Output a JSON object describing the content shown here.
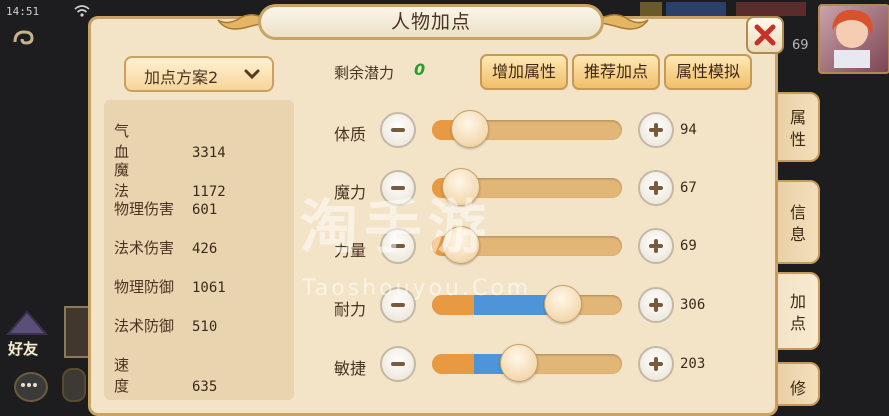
{
  "status": {
    "time": "14:51"
  },
  "hud": {
    "friends_label": "好友",
    "level": "69"
  },
  "dialog": {
    "title": "人物加点"
  },
  "plan": {
    "selected": "加点方案2"
  },
  "stats": [
    {
      "name": "气血",
      "value": "3314",
      "spread": true
    },
    {
      "name": "魔法",
      "value": "1172",
      "spread": true
    },
    {
      "name": "物理伤害",
      "value": "601",
      "spread": false
    },
    {
      "name": "法术伤害",
      "value": "426",
      "spread": false
    },
    {
      "name": "物理防御",
      "value": "1061",
      "spread": false
    },
    {
      "name": "法术防御",
      "value": "510",
      "spread": false
    },
    {
      "name": "速度",
      "value": "635",
      "spread": true
    }
  ],
  "potential": {
    "label": "剩余潜力",
    "value": "0"
  },
  "actions": {
    "add": "增加属性",
    "recommend": "推荐加点",
    "simulate": "属性模拟"
  },
  "attributes": [
    {
      "name": "体质",
      "value": "94",
      "orange_pct": 0.2,
      "blue_pct": 0.0,
      "knob_pct": 0.2
    },
    {
      "name": "魔力",
      "value": "67",
      "orange_pct": 0.15,
      "blue_pct": 0.0,
      "knob_pct": 0.15
    },
    {
      "name": "力量",
      "value": "69",
      "orange_pct": 0.15,
      "blue_pct": 0.0,
      "knob_pct": 0.15
    },
    {
      "name": "耐力",
      "value": "306",
      "orange_pct": 0.22,
      "blue_pct": 0.47,
      "knob_pct": 0.69
    },
    {
      "name": "敏捷",
      "value": "203",
      "orange_pct": 0.22,
      "blue_pct": 0.24,
      "knob_pct": 0.46
    }
  ],
  "tabs": [
    {
      "label": "属性",
      "active": false
    },
    {
      "label": "信息",
      "active": false
    },
    {
      "label": "加点",
      "active": true
    },
    {
      "label": "修",
      "active": false
    }
  ],
  "watermark": {
    "title": "淘手游",
    "url": "Taoshouyou.Com"
  },
  "colors": {
    "accent": "#f0bf69",
    "potential_green": "#2f9b2e",
    "blue_fill": "#4d94d9",
    "orange_fill": "#e89a43",
    "close_red": "#c8302a"
  }
}
